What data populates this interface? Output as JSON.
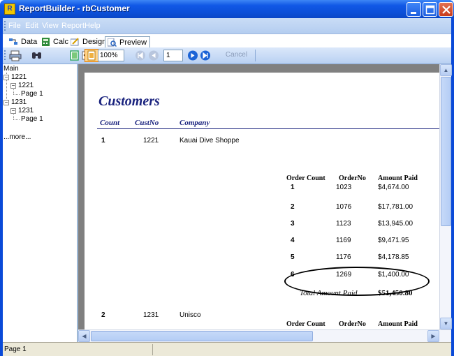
{
  "window": {
    "title": "ReportBuilder - rbCustomer",
    "icon_letter": "R"
  },
  "menu": [
    "File",
    "Edit",
    "View",
    "Report",
    "Help"
  ],
  "tabs": [
    {
      "label": "Data",
      "icon": "data-icon"
    },
    {
      "label": "Calc",
      "icon": "calc-icon"
    },
    {
      "label": "Design",
      "icon": "design-icon"
    },
    {
      "label": "Preview",
      "icon": "preview-icon",
      "active": true
    }
  ],
  "toolbar": {
    "zoom": "100%",
    "page": "1",
    "cancel_label": "Cancel"
  },
  "outline": {
    "root": "Main",
    "groups": [
      {
        "label": "1221",
        "child": "1221",
        "page": "Page 1"
      },
      {
        "label": "1231",
        "child": "1231",
        "page": "Page 1"
      }
    ],
    "more": "...more..."
  },
  "report": {
    "title": "Customers",
    "headers": {
      "count": "Count",
      "custno": "CustNo",
      "company": "Company"
    },
    "sub_headers": {
      "order_count": "Order Count",
      "order_no": "OrderNo",
      "amount_paid": "Amount Paid"
    },
    "customers": [
      {
        "count": "1",
        "custno": "1221",
        "company": "Kauai Dive Shoppe",
        "orders": [
          {
            "n": "1",
            "no": "1023",
            "amount": "$4,674.00"
          },
          {
            "n": "2",
            "no": "1076",
            "amount": "$17,781.00"
          },
          {
            "n": "3",
            "no": "1123",
            "amount": "$13,945.00"
          },
          {
            "n": "4",
            "no": "1169",
            "amount": "$9,471.95"
          },
          {
            "n": "5",
            "no": "1176",
            "amount": "$4,178.85"
          },
          {
            "n": "6",
            "no": "1269",
            "amount": "$1,400.00"
          }
        ],
        "total_label": "Total Amount Paid",
        "total_value": "$51,450.80"
      },
      {
        "count": "2",
        "custno": "1231",
        "company": "Unisco"
      }
    ]
  },
  "status": {
    "text": "Page 1"
  },
  "colors": {
    "title_bar": "#0a4ad8",
    "report_blue": "#1a237e",
    "preview_bg": "#808080"
  }
}
